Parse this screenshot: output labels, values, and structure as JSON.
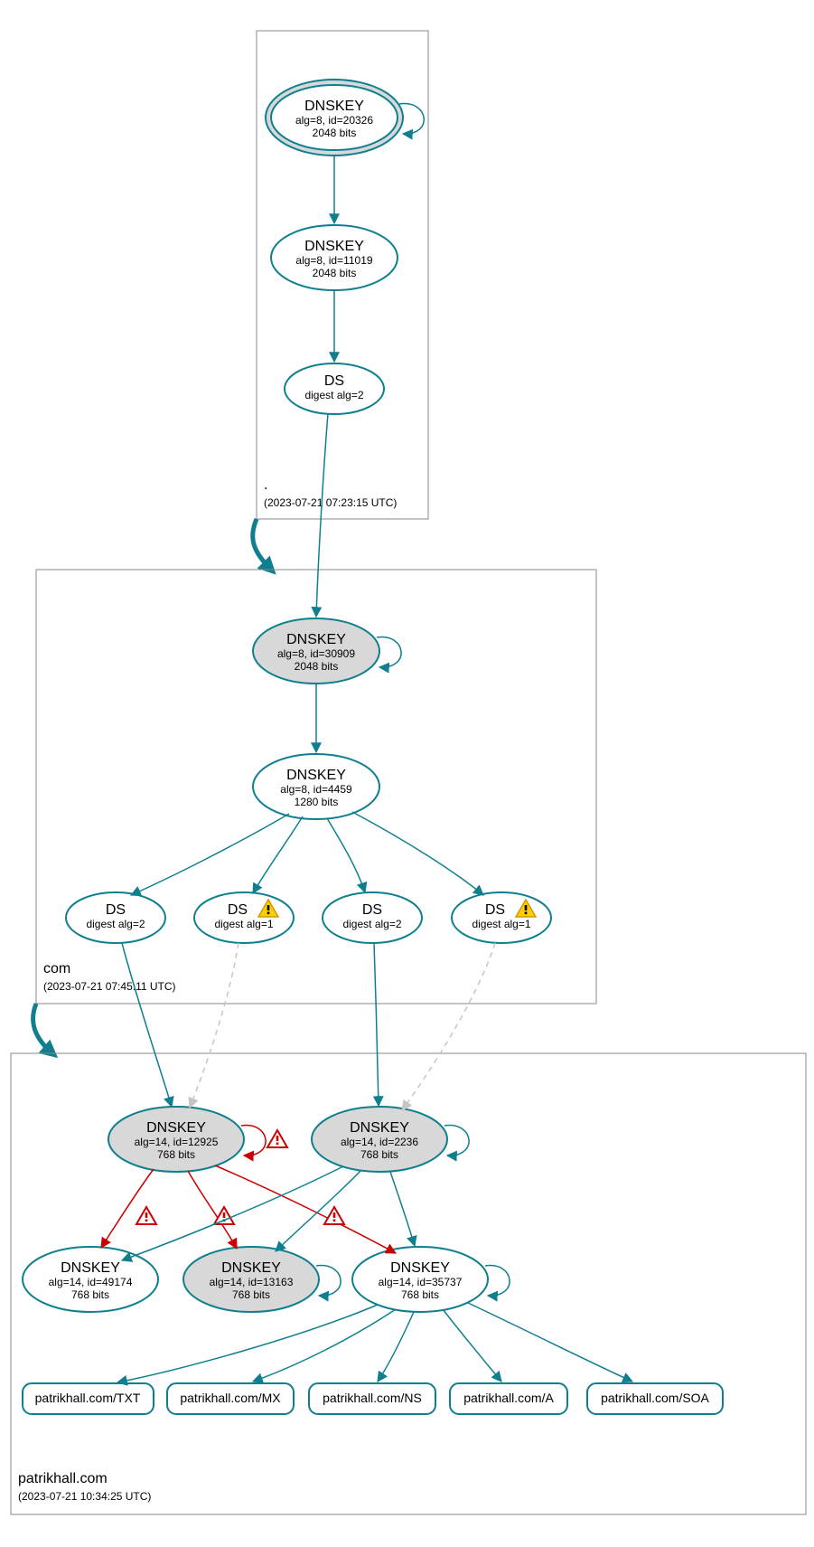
{
  "zones": {
    "root": {
      "name": ".",
      "timestamp": "(2023-07-21 07:23:15 UTC)",
      "nodes": {
        "ksk": {
          "title": "DNSKEY",
          "line2": "alg=8, id=20326",
          "line3": "2048 bits"
        },
        "zsk": {
          "title": "DNSKEY",
          "line2": "alg=8, id=11019",
          "line3": "2048 bits"
        },
        "ds": {
          "title": "DS",
          "line2": "digest alg=2"
        }
      }
    },
    "com": {
      "name": "com",
      "timestamp": "(2023-07-21 07:45:11 UTC)",
      "nodes": {
        "ksk": {
          "title": "DNSKEY",
          "line2": "alg=8, id=30909",
          "line3": "2048 bits"
        },
        "zsk": {
          "title": "DNSKEY",
          "line2": "alg=8, id=4459",
          "line3": "1280 bits"
        },
        "ds1": {
          "title": "DS",
          "line2": "digest alg=2"
        },
        "ds2": {
          "title": "DS",
          "line2": "digest alg=1"
        },
        "ds3": {
          "title": "DS",
          "line2": "digest alg=2"
        },
        "ds4": {
          "title": "DS",
          "line2": "digest alg=1"
        }
      }
    },
    "domain": {
      "name": "patrikhall.com",
      "timestamp": "(2023-07-21 10:34:25 UTC)",
      "nodes": {
        "ksk1": {
          "title": "DNSKEY",
          "line2": "alg=14, id=12925",
          "line3": "768 bits"
        },
        "ksk2": {
          "title": "DNSKEY",
          "line2": "alg=14, id=2236",
          "line3": "768 bits"
        },
        "zsk1": {
          "title": "DNSKEY",
          "line2": "alg=14, id=49174",
          "line3": "768 bits"
        },
        "zsk2": {
          "title": "DNSKEY",
          "line2": "alg=14, id=13163",
          "line3": "768 bits"
        },
        "zsk3": {
          "title": "DNSKEY",
          "line2": "alg=14, id=35737",
          "line3": "768 bits"
        }
      },
      "rrsets": {
        "txt": "patrikhall.com/TXT",
        "mx": "patrikhall.com/MX",
        "ns": "patrikhall.com/NS",
        "a": "patrikhall.com/A",
        "soa": "patrikhall.com/SOA"
      }
    }
  }
}
